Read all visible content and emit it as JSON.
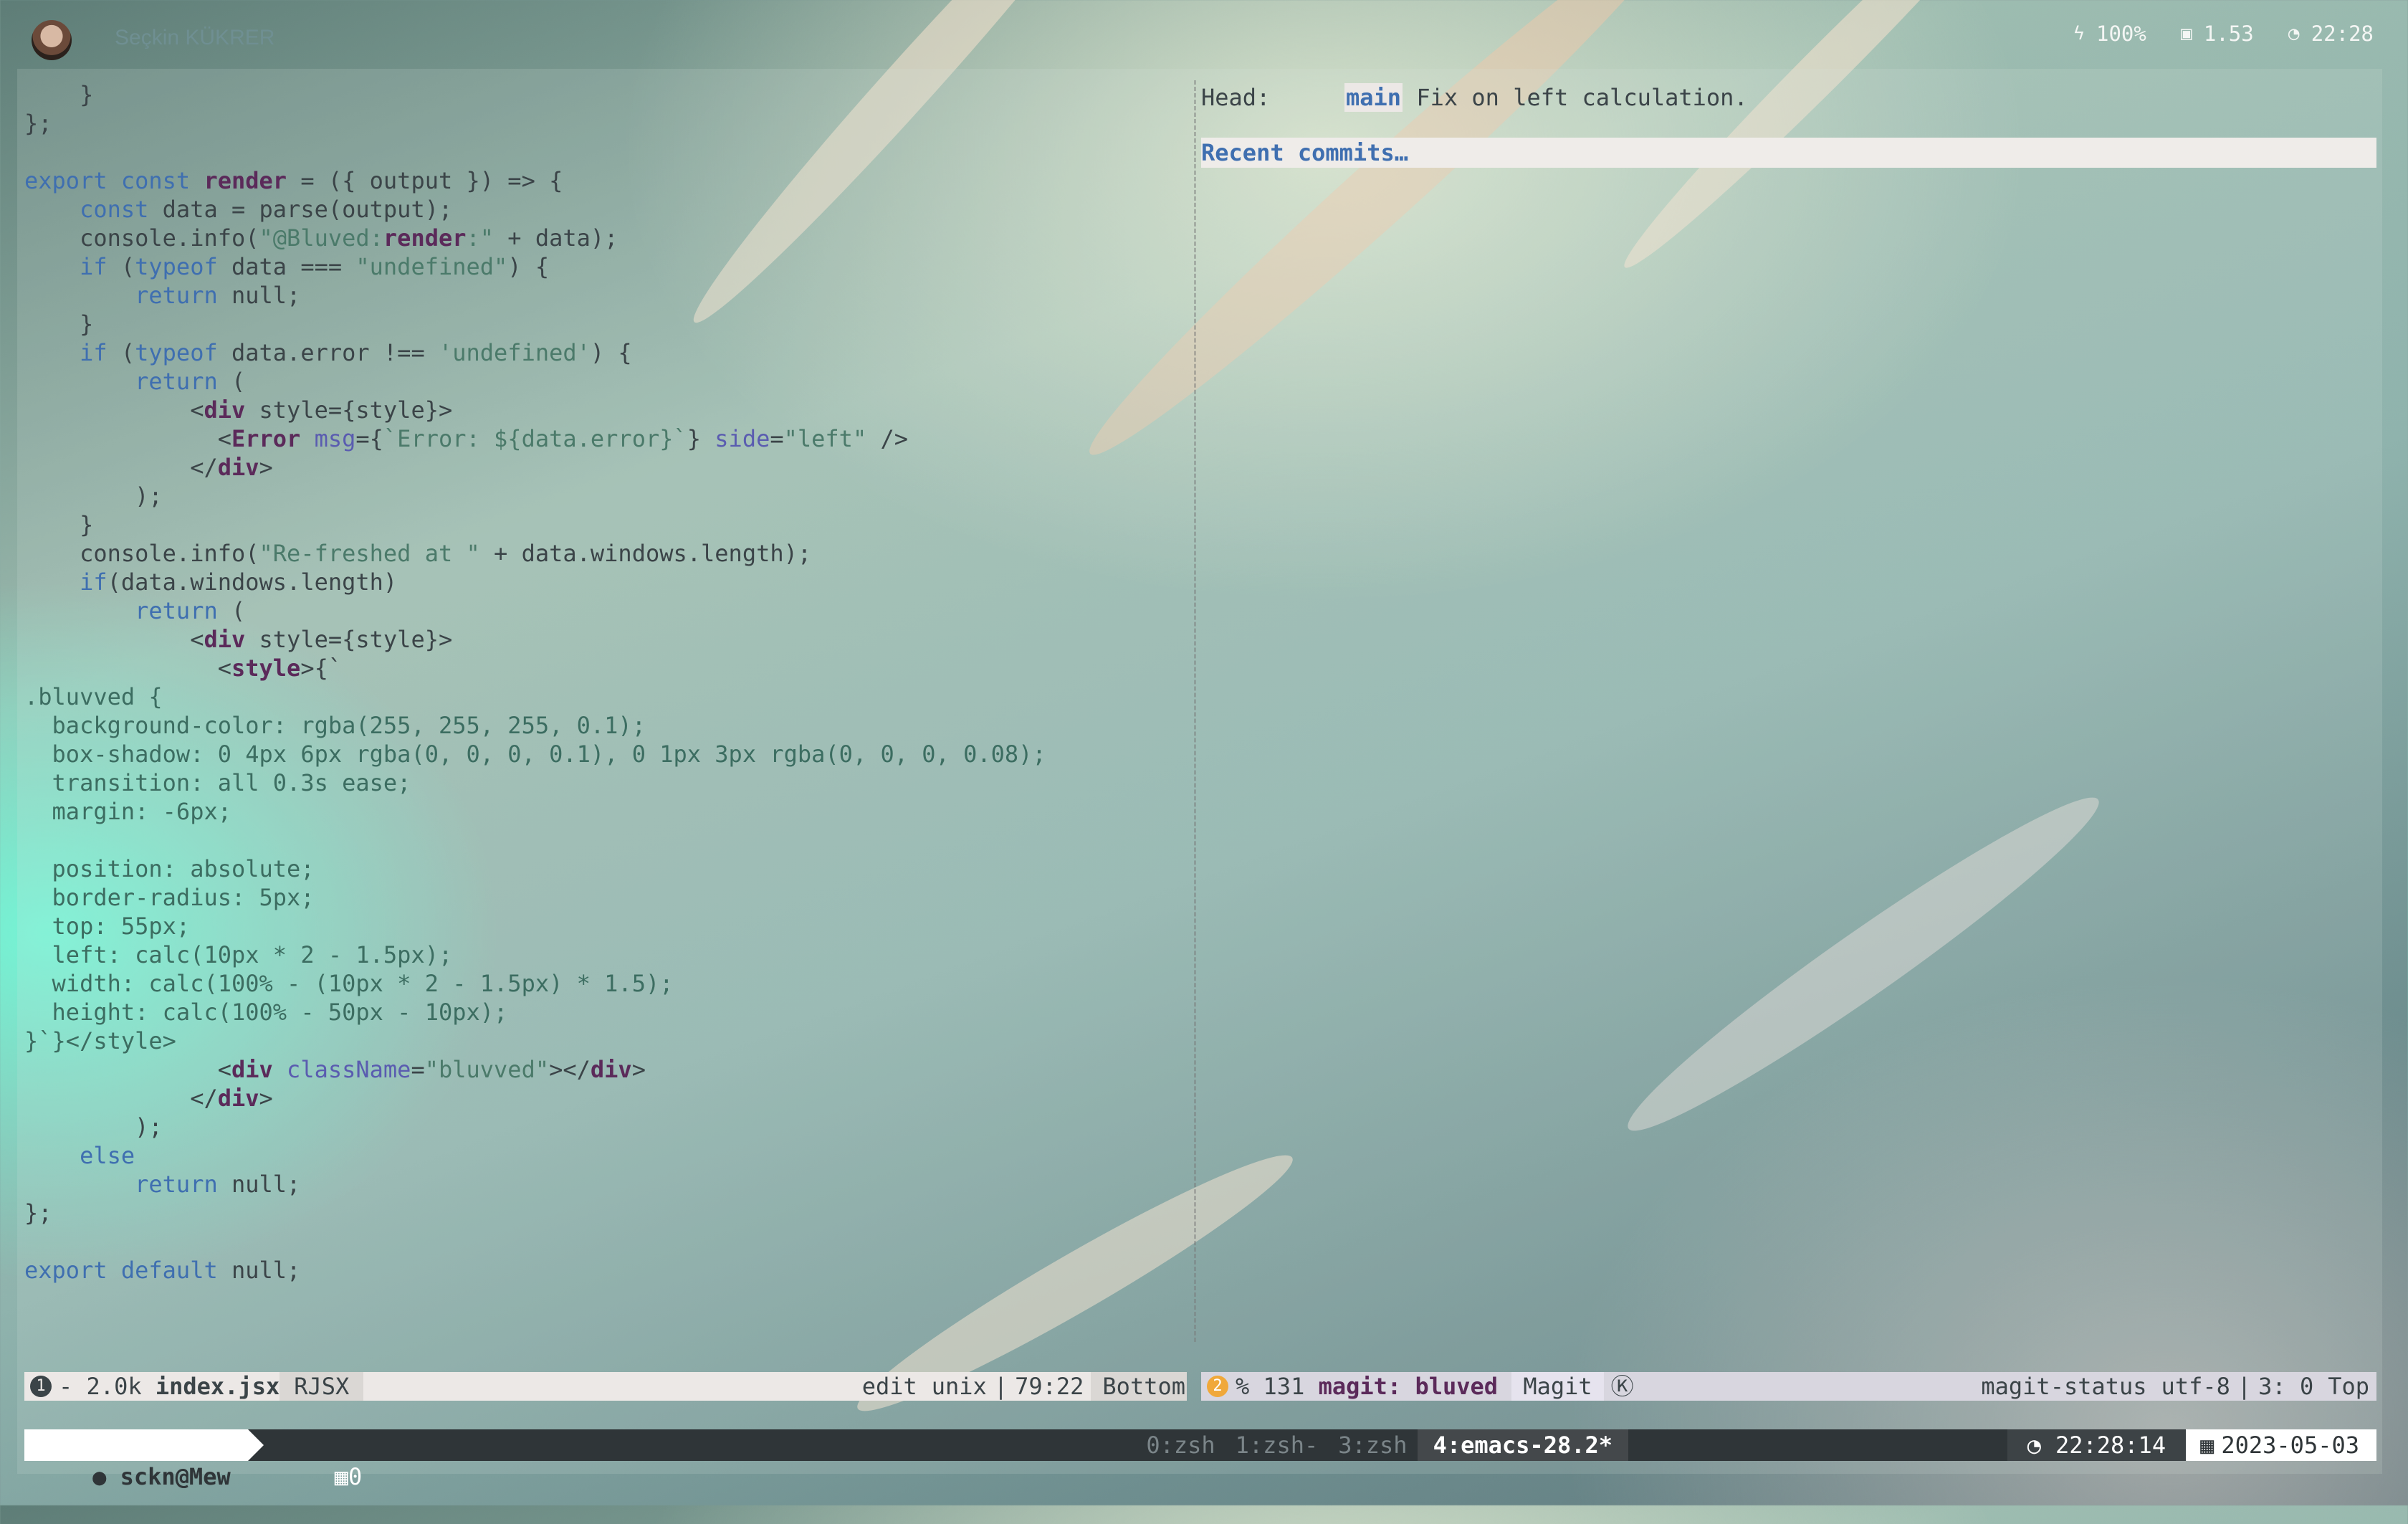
{
  "topbar": {
    "username": "Seçkin KÜKRER",
    "battery": "100%",
    "cpu_load": "1.53",
    "time": "22:28",
    "icons": {
      "battery": "lightning-icon",
      "cpu": "cpu-chip-icon",
      "clock": "clock-icon"
    }
  },
  "editor": {
    "lines": [
      "    }",
      "};",
      "",
      "export const render = ({ output }) => {",
      "    const data = parse(output);",
      "    console.info(\"@Bluved:render:\" + data);",
      "    if (typeof data === \"undefined\") {",
      "        return null;",
      "    }",
      "    if (typeof data.error !== 'undefined') {",
      "        return (",
      "            <div style={style}>",
      "              <Error msg={`Error: ${data.error}`} side=\"left\" />",
      "            </div>",
      "        );",
      "    }",
      "    console.info(\"Re-freshed at \" + data.windows.length);",
      "    if(data.windows.length)",
      "        return (",
      "            <div style={style}>",
      "              <style>{`",
      ".bluvved {",
      "  background-color: rgba(255, 255, 255, 0.1);",
      "  box-shadow: 0 4px 6px rgba(0, 0, 0, 0.1), 0 1px 3px rgba(0, 0, 0, 0.08);",
      "  transition: all 0.3s ease;",
      "  margin: -6px;",
      "",
      "  position: absolute;",
      "  border-radius: 5px;",
      "  top: 55px;",
      "  left: calc(10px * 2 - 1.5px);",
      "  width: calc(100% - (10px * 2 - 1.5px) * 1.5);",
      "  height: calc(100% - 50px - 10px);",
      "}`}</style>",
      "              <div className=\"bluvved\"></div>",
      "            </div>",
      "        );",
      "    else",
      "        return null;",
      "};",
      "",
      "export default null;"
    ]
  },
  "magit": {
    "head_label": "Head:",
    "branch": "main",
    "commit_message": "Fix on left calculation.",
    "recent_commits": "Recent commits…"
  },
  "modeline_left": {
    "window_number": "1",
    "modified": "-",
    "size": "2.0k",
    "filename": "index.jsx",
    "major_mode": "RJSX",
    "state": "edit",
    "eol": "unix",
    "position": "79:22",
    "scroll": "Bottom"
  },
  "modeline_right": {
    "window_number": "2",
    "percent": "%",
    "line_count": "131",
    "buffer": "magit: bluved",
    "major_mode": "Magit",
    "minor_mode_glyph": "Ⓚ",
    "submode": "magit-status",
    "encoding": "utf-8",
    "position": "3: 0",
    "scroll": "Top"
  },
  "tmux": {
    "user": "sckn@Mew",
    "window_count": "0",
    "windows": [
      "0:zsh",
      "1:zsh-",
      "3:zsh"
    ],
    "active_window": "4:emacs-28.2*",
    "clock": "22:28:14",
    "date": "2023-05-03"
  }
}
